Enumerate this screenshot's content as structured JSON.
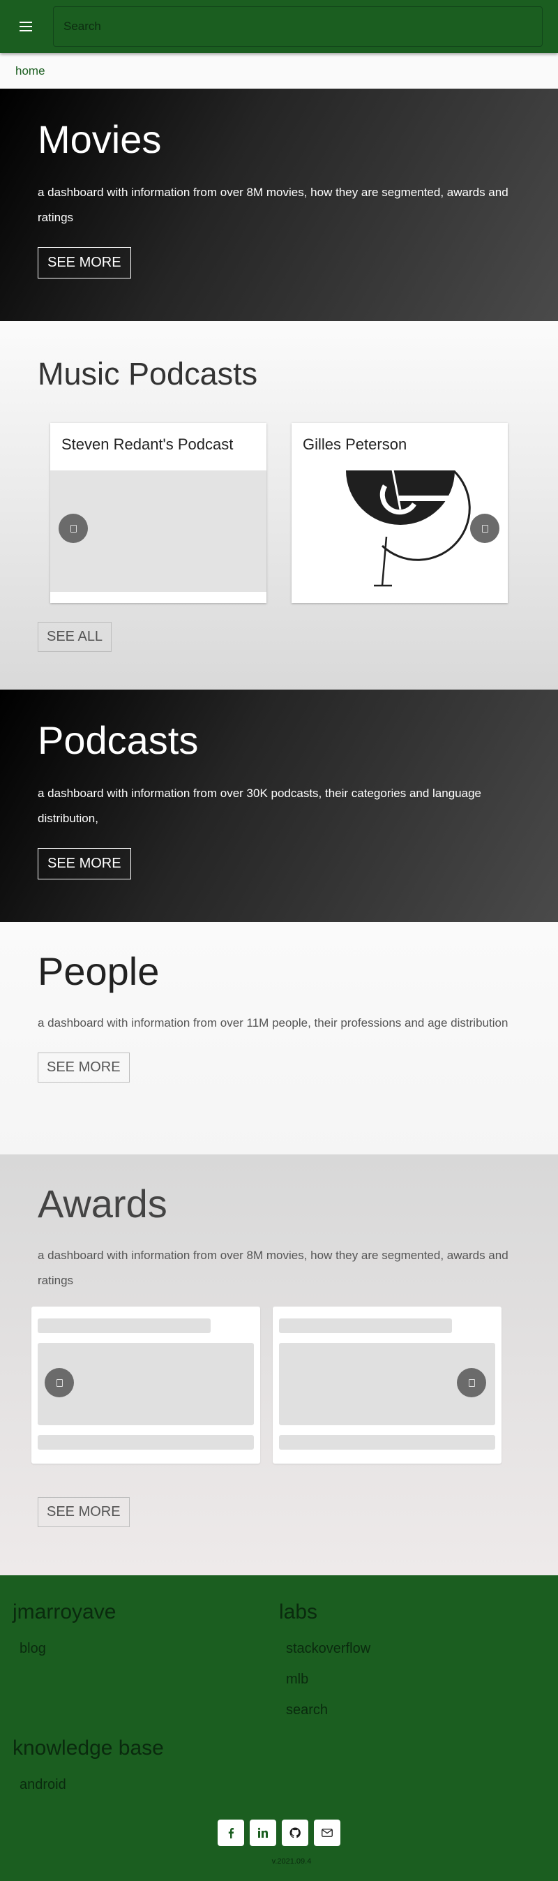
{
  "topbar": {
    "search_placeholder": "Search"
  },
  "breadcrumb": {
    "home": "home"
  },
  "movies": {
    "title": "Movies",
    "description": "a dashboard with information from over 8M movies, how they are segmented, awards and ratings",
    "button": "SEE MORE"
  },
  "music_podcasts": {
    "title": "Music Podcasts",
    "cards": [
      {
        "title": "Steven Redant's Podcast"
      },
      {
        "title": "Gilles Peterson"
      }
    ],
    "button": "SEE ALL"
  },
  "podcasts": {
    "title": "Podcasts",
    "description": "a dashboard with information from over 30K podcasts, their categories and language distribution,",
    "button": "SEE MORE"
  },
  "people": {
    "title": "People",
    "description": "a dashboard with information from over 11M people, their professions and age distribution",
    "button": "SEE MORE"
  },
  "awards": {
    "title": "Awards",
    "description": "a dashboard with information from over 8M movies, how they are segmented, awards and ratings",
    "button": "SEE MORE"
  },
  "footer": {
    "col1_title": "jmarroyave",
    "col1_links": [
      "blog"
    ],
    "col2_title": "labs",
    "col2_links": [
      "stackoverflow",
      "mlb",
      "search"
    ],
    "col3_title": "knowledge base",
    "col3_links": [
      "android"
    ],
    "social_icons": [
      "facebook-icon",
      "linkedin-icon",
      "github-icon",
      "email-icon"
    ],
    "version": "v.2021.09.4"
  },
  "colors": {
    "brand_green": "#1b5e20",
    "footer_text": "#0a2a0e"
  }
}
